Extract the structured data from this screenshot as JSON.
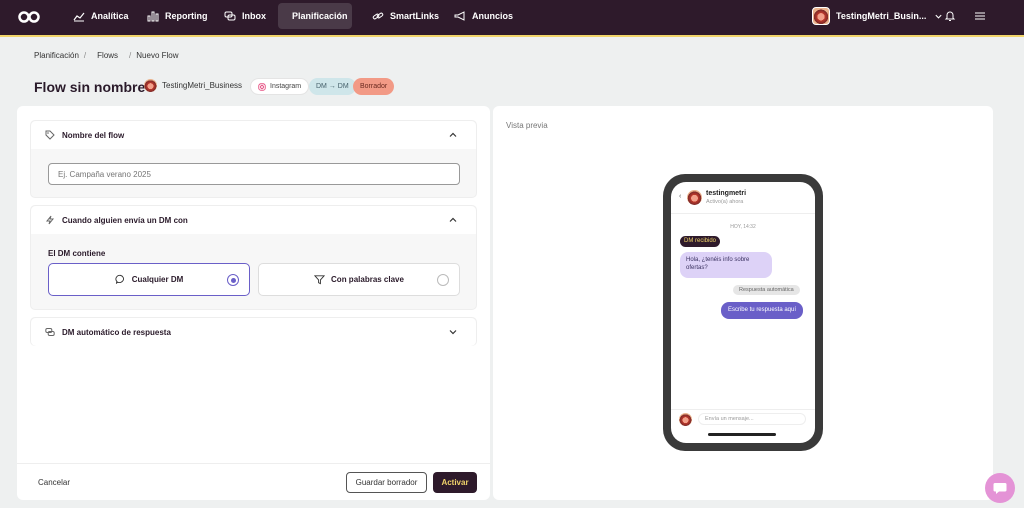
{
  "nav": {
    "items": [
      {
        "label": "Analítica",
        "icon": "chart-line-icon"
      },
      {
        "label": "Reporting",
        "icon": "bar-chart-icon"
      },
      {
        "label": "Inbox",
        "icon": "chat-icon"
      },
      {
        "label": "Planificación",
        "icon": "calendar-icon"
      },
      {
        "label": "SmartLinks",
        "icon": "link-icon"
      },
      {
        "label": "Anuncios",
        "icon": "megaphone-icon"
      }
    ],
    "account": "TestingMetri_Busin..."
  },
  "breadcrumb": [
    "Planificación",
    "Flows",
    "Nuevo Flow"
  ],
  "header": {
    "title": "Flow sin nombre",
    "account": "TestingMetri_Business",
    "platform": "Instagram",
    "type": "DM → DM",
    "status": "Borrador"
  },
  "form": {
    "section1": {
      "title": "Nombre del flow",
      "placeholder": "Ej. Campaña verano 2025"
    },
    "section2": {
      "title": "Cuando alguien envía un DM con",
      "label": "El DM contiene",
      "options": [
        {
          "label": "Cualquier DM",
          "selected": true
        },
        {
          "label": "Con palabras clave",
          "selected": false
        }
      ]
    },
    "section3": {
      "title": "DM automático de respuesta"
    }
  },
  "footer": {
    "cancel": "Cancelar",
    "save": "Guardar borrador",
    "activate": "Activar"
  },
  "preview": {
    "label": "Vista previa",
    "username": "testingmetri",
    "status": "Activo(a) ahora",
    "time": "HOY, 14:32",
    "badge": "DM recibido",
    "incoming": "Hola, ¿tenéis info sobre ofertas?",
    "auto_label": "Respuesta automática",
    "outgoing": "Escribe tu respuesta aquí",
    "input_placeholder": "Envía un mensaje..."
  },
  "colors": {
    "nav_bg": "#2e1a2b",
    "accent_yellow": "#f1d46a",
    "accent_purple": "#6a5fc8",
    "draft_pill": "#f29a86"
  }
}
